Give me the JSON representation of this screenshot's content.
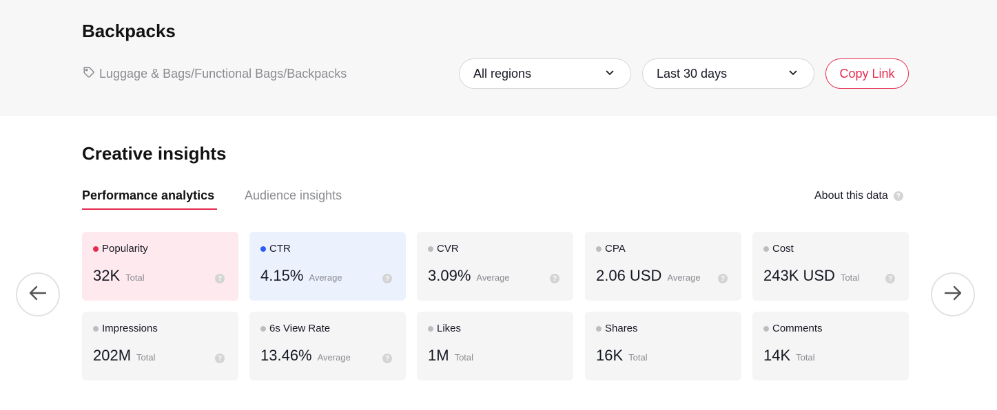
{
  "header": {
    "title": "Backpacks",
    "breadcrumb": "Luggage & Bags/Functional Bags/Backpacks",
    "region_select": "All regions",
    "date_select": "Last 30 days",
    "copy_link": "Copy Link"
  },
  "section": {
    "title": "Creative insights",
    "tabs": [
      "Performance analytics",
      "Audience insights"
    ],
    "about": "About this data"
  },
  "colors": {
    "accent": "#e6294f",
    "ctr_dot": "#2d5cf6",
    "pink_card": "#fde9ee",
    "blue_card": "#ebf2fe"
  },
  "cards": [
    {
      "label": "Popularity",
      "value": "32K",
      "unit": "Total"
    },
    {
      "label": "CTR",
      "value": "4.15%",
      "unit": "Average"
    },
    {
      "label": "CVR",
      "value": "3.09%",
      "unit": "Average"
    },
    {
      "label": "CPA",
      "value": "2.06 USD",
      "unit": "Average"
    },
    {
      "label": "Cost",
      "value": "243K USD",
      "unit": "Total"
    },
    {
      "label": "Impressions",
      "value": "202M",
      "unit": "Total"
    },
    {
      "label": "6s View Rate",
      "value": "13.46%",
      "unit": "Average"
    },
    {
      "label": "Likes",
      "value": "1M",
      "unit": "Total"
    },
    {
      "label": "Shares",
      "value": "16K",
      "unit": "Total"
    },
    {
      "label": "Comments",
      "value": "14K",
      "unit": "Total"
    }
  ],
  "icons": {
    "help": "?"
  }
}
